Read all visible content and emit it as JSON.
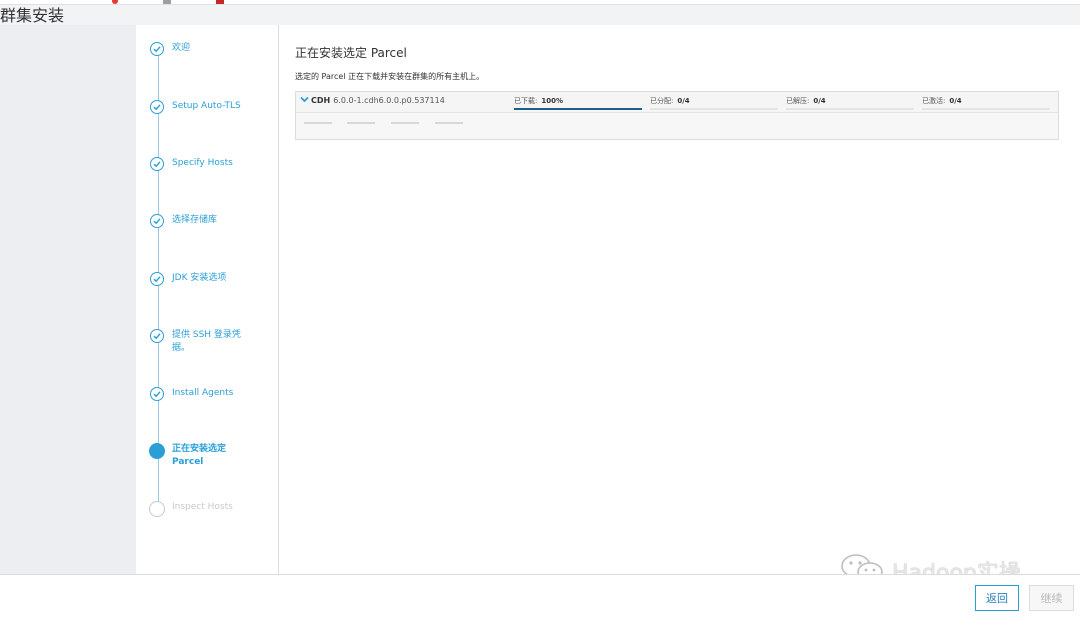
{
  "page_title": "群集安装",
  "wizard": {
    "steps": [
      {
        "label": "欢迎",
        "state": "done"
      },
      {
        "label": "Setup Auto-TLS",
        "state": "done"
      },
      {
        "label": "Specify Hosts",
        "state": "done"
      },
      {
        "label": "选择存储库",
        "state": "done"
      },
      {
        "label": "JDK 安装选项",
        "state": "done"
      },
      {
        "label": "提供 SSH 登录凭\n据。",
        "state": "done"
      },
      {
        "label": "Install Agents",
        "state": "done"
      },
      {
        "label": "正在安装选定\nParcel",
        "state": "active"
      },
      {
        "label": "Inspect Hosts",
        "state": "todo"
      }
    ]
  },
  "main": {
    "title": "正在安装选定 Parcel",
    "subtitle": "选定的 Parcel 正在下载并安装在群集的所有主机上。",
    "parcel": {
      "name": "CDH",
      "version": "6.0.0-1.cdh6.0.0.p0.537114",
      "stages": [
        {
          "label": "已下载:",
          "value": "100%",
          "progress": 100
        },
        {
          "label": "已分配:",
          "value": "0/4",
          "progress": 0
        },
        {
          "label": "已解压:",
          "value": "0/4",
          "progress": 0
        },
        {
          "label": "已激活:",
          "value": "0/4",
          "progress": 0
        }
      ]
    }
  },
  "footer": {
    "back_label": "返回",
    "continue_label": "继续"
  },
  "watermark": {
    "text": "Hadoop实操",
    "icon": "wechat-icon"
  },
  "colors": {
    "accent": "#2a9fd6",
    "progress_fill": "#1e5f8a",
    "disabled_text": "#c9c9c9"
  }
}
